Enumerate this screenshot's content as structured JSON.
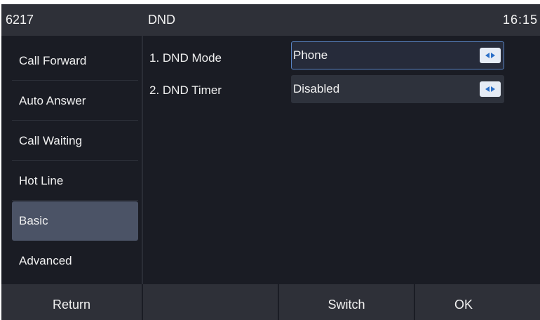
{
  "statusbar": {
    "account": "6217",
    "title": "DND",
    "time": "16:15"
  },
  "sidebar": {
    "items": [
      {
        "label": "Call Forward",
        "active": false
      },
      {
        "label": "Auto Answer",
        "active": false
      },
      {
        "label": "Call Waiting",
        "active": false
      },
      {
        "label": "Hot Line",
        "active": false
      },
      {
        "label": "Basic",
        "active": true
      },
      {
        "label": "Advanced",
        "active": false
      }
    ]
  },
  "settings": {
    "rows": [
      {
        "label": "1. DND Mode",
        "value": "Phone",
        "focused": true
      },
      {
        "label": "2. DND Timer",
        "value": "Disabled",
        "focused": false
      }
    ]
  },
  "softkeys": {
    "return_label": "Return",
    "empty_label": "",
    "switch_label": "Switch",
    "ok_label": "OK"
  },
  "colors": {
    "background": "#1a1c24",
    "bar": "#2e3038",
    "active_item": "#4b5366",
    "accent": "#2b6fc7",
    "focus_border": "#5a86c7"
  },
  "icons": {
    "selector": "left-right-arrows-icon"
  }
}
